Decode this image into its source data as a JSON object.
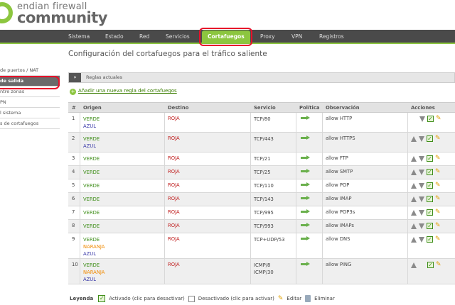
{
  "brand": {
    "line1": "endian firewall",
    "line2": "community"
  },
  "topnav": {
    "items": [
      "Sistema",
      "Estado",
      "Red",
      "Servicios",
      "Cortafuegos",
      "Proxy",
      "VPN",
      "Registros"
    ],
    "active": "Cortafuegos"
  },
  "sidebar": {
    "items": [
      "de puertos / NAT",
      "de salida",
      "ntre zonas",
      "PN",
      "l sistema",
      "s de cortafuegos"
    ],
    "active_index": 1
  },
  "page_title": "Configuración del cortafuegos para el tráfico saliente",
  "section": {
    "toggle": "»",
    "label": "Reglas actuales"
  },
  "add_rule": "Añadir una nueva regla del cortafuegos",
  "table": {
    "headers": {
      "num": "#",
      "origin": "Origen",
      "dest": "Destino",
      "service": "Servicio",
      "policy": "Política",
      "note": "Observación",
      "actions": "Acciones"
    },
    "rows": [
      {
        "num": "1",
        "origin": [
          "VERDE",
          "AZUL"
        ],
        "dest": "ROJA",
        "service": [
          "TCP/80"
        ],
        "note": "allow HTTP",
        "up": false,
        "down": true
      },
      {
        "num": "2",
        "origin": [
          "VERDE",
          "AZUL"
        ],
        "dest": "ROJA",
        "service": [
          "TCP/443"
        ],
        "note": "allow HTTPS",
        "up": true,
        "down": true
      },
      {
        "num": "3",
        "origin": [
          "VERDE"
        ],
        "dest": "ROJA",
        "service": [
          "TCP/21"
        ],
        "note": "allow FTP",
        "up": true,
        "down": true
      },
      {
        "num": "4",
        "origin": [
          "VERDE"
        ],
        "dest": "ROJA",
        "service": [
          "TCP/25"
        ],
        "note": "allow SMTP",
        "up": true,
        "down": true
      },
      {
        "num": "5",
        "origin": [
          "VERDE"
        ],
        "dest": "ROJA",
        "service": [
          "TCP/110"
        ],
        "note": "allow POP",
        "up": true,
        "down": true
      },
      {
        "num": "6",
        "origin": [
          "VERDE"
        ],
        "dest": "ROJA",
        "service": [
          "TCP/143"
        ],
        "note": "allow IMAP",
        "up": true,
        "down": true
      },
      {
        "num": "7",
        "origin": [
          "VERDE"
        ],
        "dest": "ROJA",
        "service": [
          "TCP/995"
        ],
        "note": "allow POP3s",
        "up": true,
        "down": true
      },
      {
        "num": "8",
        "origin": [
          "VERDE"
        ],
        "dest": "ROJA",
        "service": [
          "TCP/993"
        ],
        "note": "allow IMAPs",
        "up": true,
        "down": true
      },
      {
        "num": "9",
        "origin": [
          "VERDE",
          "NARANJA",
          "AZUL"
        ],
        "dest": "ROJA",
        "service": [
          "TCP+UDP/53"
        ],
        "note": "allow DNS",
        "up": true,
        "down": true
      },
      {
        "num": "10",
        "origin": [
          "VERDE",
          "NARANJA",
          "AZUL"
        ],
        "dest": "ROJA",
        "service": [
          "ICMP/8",
          "ICMP/30"
        ],
        "note": "allow PING",
        "up": true,
        "down": false
      }
    ]
  },
  "legend": {
    "title": "Leyenda",
    "enabled": "Activado (clic para desactivar)",
    "disabled": "Desactivado (clic para activar)",
    "edit": "Editar",
    "delete": "Eliminar"
  },
  "colors": {
    "VERDE": "#3f8e1a",
    "AZUL": "#3a3aa8",
    "NARANJA": "#f08a00",
    "ROJA": "#c02020",
    "accent": "#8cc63f",
    "highlight": "#e8102a"
  }
}
